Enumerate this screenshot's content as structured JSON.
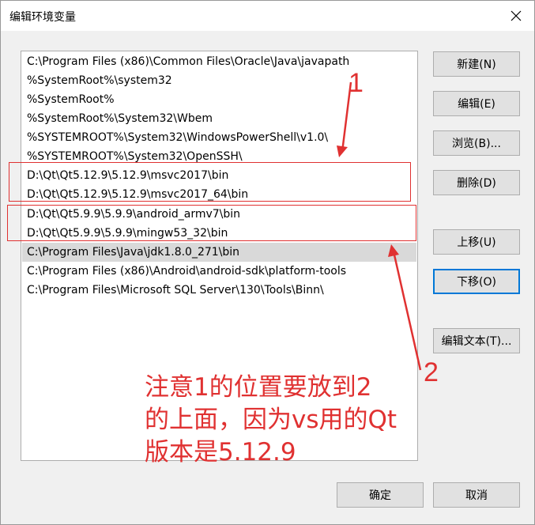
{
  "window": {
    "title": "编辑环境变量",
    "close_glyph": "✕"
  },
  "list": {
    "items": [
      {
        "text": "C:\\Program Files (x86)\\Common Files\\Oracle\\Java\\javapath",
        "selected": false
      },
      {
        "text": "%SystemRoot%\\system32",
        "selected": false
      },
      {
        "text": "%SystemRoot%",
        "selected": false
      },
      {
        "text": "%SystemRoot%\\System32\\Wbem",
        "selected": false
      },
      {
        "text": "%SYSTEMROOT%\\System32\\WindowsPowerShell\\v1.0\\",
        "selected": false
      },
      {
        "text": "%SYSTEMROOT%\\System32\\OpenSSH\\",
        "selected": false
      },
      {
        "text": "D:\\Qt\\Qt5.12.9\\5.12.9\\msvc2017\\bin",
        "selected": false
      },
      {
        "text": "D:\\Qt\\Qt5.12.9\\5.12.9\\msvc2017_64\\bin",
        "selected": false
      },
      {
        "text": "D:\\Qt\\Qt5.9.9\\5.9.9\\android_armv7\\bin",
        "selected": false
      },
      {
        "text": "D:\\Qt\\Qt5.9.9\\5.9.9\\mingw53_32\\bin",
        "selected": false
      },
      {
        "text": "C:\\Program Files\\Java\\jdk1.8.0_271\\bin",
        "selected": true
      },
      {
        "text": "C:\\Program Files (x86)\\Android\\android-sdk\\platform-tools",
        "selected": false
      },
      {
        "text": "C:\\Program Files\\Microsoft SQL Server\\130\\Tools\\Binn\\",
        "selected": false
      }
    ]
  },
  "buttons": {
    "new": "新建(N)",
    "edit": "编辑(E)",
    "browse": "浏览(B)...",
    "delete": "删除(D)",
    "move_up": "上移(U)",
    "move_down": "下移(O)",
    "edit_text": "编辑文本(T)...",
    "ok": "确定",
    "cancel": "取消"
  },
  "annotations": {
    "label_1": "1",
    "label_2": "2",
    "note_lines": [
      "注意1的位置要放到2",
      "的上面，因为vs用的Qt",
      "版本是5.12.9"
    ],
    "color": "#e03131"
  }
}
